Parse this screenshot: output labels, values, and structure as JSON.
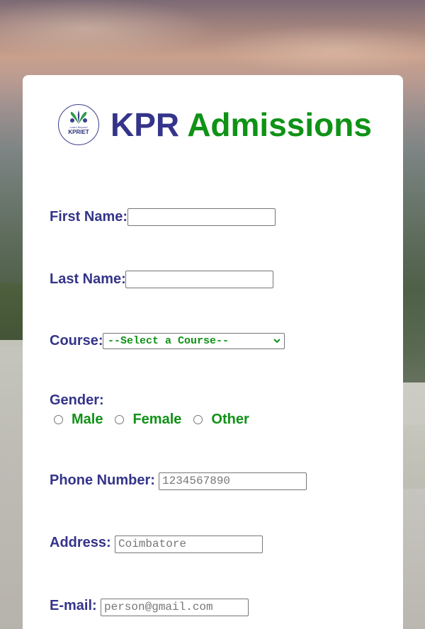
{
  "header": {
    "title_part1": "KPR",
    "title_part2": "Admissions",
    "logo": {
      "icon": "kpriet-logo-icon",
      "tagline": "Learn Beyond",
      "name": "KPRIET"
    }
  },
  "form": {
    "first_name": {
      "label": "First Name:",
      "value": ""
    },
    "last_name": {
      "label": "Last Name:",
      "value": ""
    },
    "course": {
      "label": "Course:",
      "selected": "--Select a Course--"
    },
    "gender": {
      "label": "Gender:",
      "options": [
        "Male",
        "Female",
        "Other"
      ]
    },
    "phone": {
      "label": "Phone Number:",
      "placeholder": "1234567890"
    },
    "address": {
      "label": "Address:",
      "placeholder": "Coimbatore"
    },
    "email": {
      "label": "E-mail:",
      "placeholder": "person@gmail.com"
    }
  },
  "colors": {
    "primary_blue": "#34348a",
    "accent_green": "#0f9216"
  }
}
